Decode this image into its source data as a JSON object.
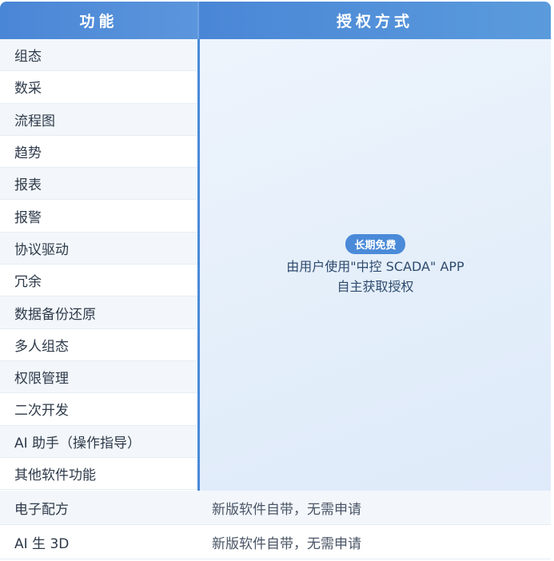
{
  "header": {
    "col1": "功能",
    "col2": "授权方式"
  },
  "features": [
    "组态",
    "数采",
    "流程图",
    "趋势",
    "报表",
    "报警",
    "协议驱动",
    "冗余",
    "数据备份还原",
    "多人组态",
    "权限管理",
    "二次开发",
    "AI 助手（操作指导）",
    "其他软件功能"
  ],
  "merged": {
    "badge": "长期免费",
    "line1": "由用户使用\"中控 SCADA\" APP",
    "line2": "自主获取授权"
  },
  "bottom_rows": [
    {
      "feature": "电子配方",
      "auth": "新版软件自带，无需申请"
    },
    {
      "feature": "AI 生 3D",
      "auth": "新版软件自带，无需申请"
    }
  ],
  "colors": {
    "header_blue": "#4a86d6",
    "badge_blue": "#4a8ad8"
  }
}
